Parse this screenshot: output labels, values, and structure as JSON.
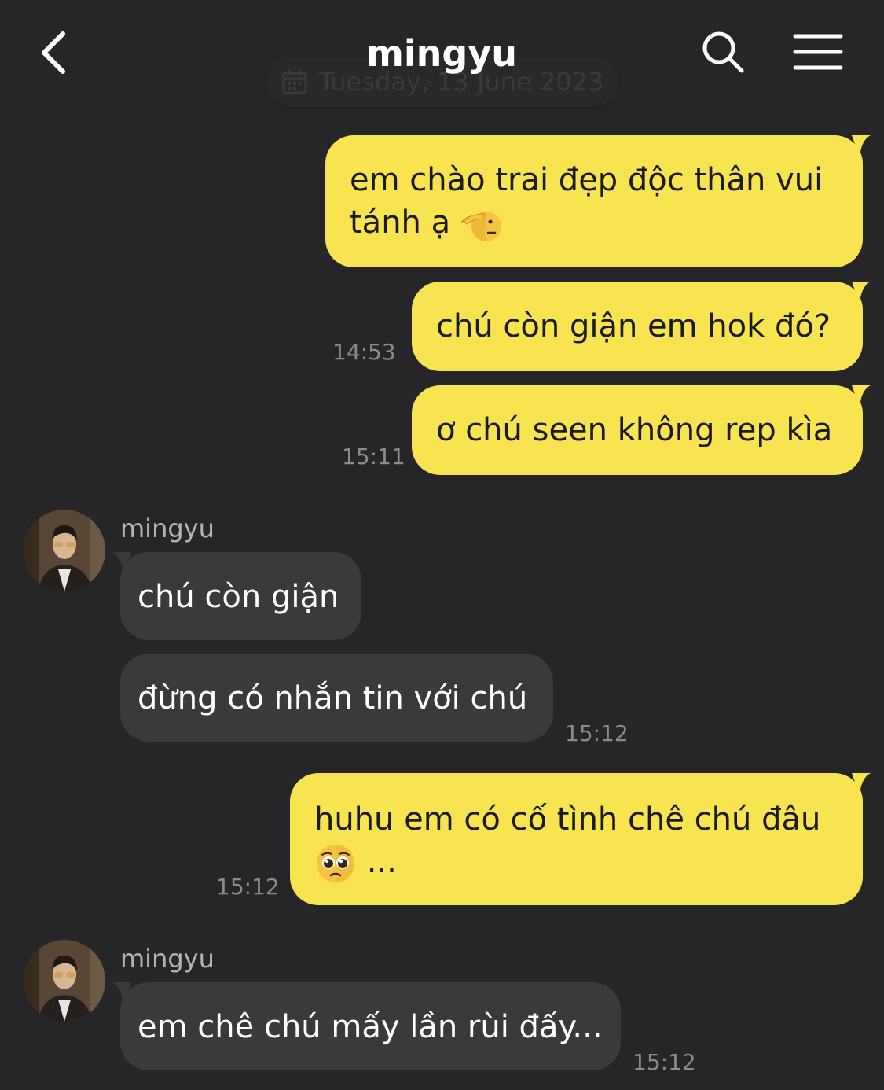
{
  "header": {
    "title": "mingyu",
    "date_banner": "Tuesday, 13 June 2023"
  },
  "colors": {
    "background": "#262628",
    "outgoing_bubble": "#f8e450",
    "incoming_bubble": "#3a3a3c",
    "timestamp": "#8b8b8e"
  },
  "icons": [
    "back-icon",
    "search-icon",
    "menu-icon",
    "calendar-icon",
    "saluting-face-emoji",
    "pleading-face-emoji"
  ],
  "messages": [
    {
      "direction": "out",
      "text_line1": "em chào trai đẹp độc thân vui",
      "text_line2": "tánh ạ",
      "emoji": "saluting-face",
      "time": ""
    },
    {
      "direction": "out",
      "text": "chú còn giận em hok đó?",
      "time": "14:53"
    },
    {
      "direction": "out",
      "text": "ơ chú seen không rep kìa",
      "time": "15:11"
    },
    {
      "direction": "in",
      "sender": "mingyu",
      "text": "chú còn giận",
      "time": ""
    },
    {
      "direction": "in",
      "text": "đừng có nhắn tin với chú",
      "time": "15:12"
    },
    {
      "direction": "out",
      "text_line1": "huhu em có cố tình chê chú đâu",
      "text_line2": "...",
      "emoji": "pleading-face",
      "time": "15:12"
    },
    {
      "direction": "in",
      "sender": "mingyu",
      "text": "em chê chú mấy lần rùi đấy...",
      "time": "15:12"
    }
  ]
}
